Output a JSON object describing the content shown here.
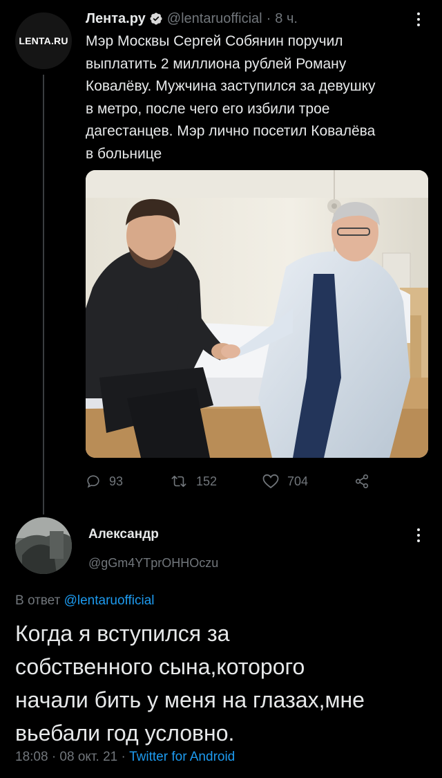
{
  "tweet": {
    "avatar_text": "LENTA.RU",
    "author_name": "Лента.ру",
    "verified_icon": "verified-badge-icon",
    "handle": "@lentaruofficial",
    "separator": "·",
    "time": "8 ч.",
    "text": "Мэр Москвы Сергей Собянин поручил\nвыплатить 2 миллиона рублей Роману\nКовалёву. Мужчина заступился за девушку\nв метро, после чего его избили трое\nдагестанцев. Мэр лично посетил Ковалёва\nв больнице",
    "stats": {
      "replies": "93",
      "retweets": "152",
      "likes": "704"
    }
  },
  "reply": {
    "author_name": "Александр",
    "handle": "@gGm4YTprOHHOczu",
    "reply_to_prefix": "В ответ",
    "reply_to_handle": "@lentaruofficial",
    "text": "Когда я вступился за\nсобственного сына,которого\nначали бить у меня на глазах,мне\nвьебали год условно.",
    "timestamp": "18:08 · 08 окт. 21 ·",
    "client": "Twitter for Android"
  },
  "colors": {
    "background": "#000000",
    "text_primary": "#e7e9ea",
    "text_secondary": "#71767b",
    "link": "#1d9bf0"
  }
}
